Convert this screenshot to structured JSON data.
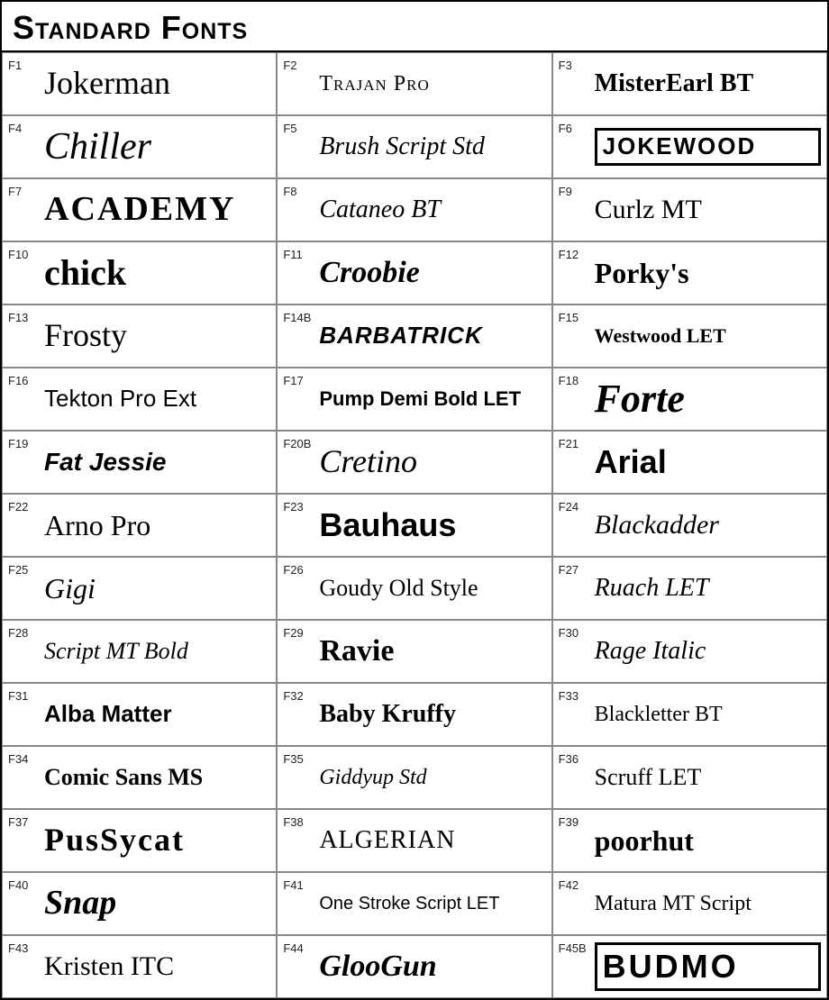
{
  "title": "Standard Fonts",
  "fonts": [
    {
      "code": "F1",
      "name": "Jokerman",
      "style": "f-jokerman"
    },
    {
      "code": "F2",
      "name": "Trajan Pro",
      "style": "f-trajan"
    },
    {
      "code": "F3",
      "name": "MisterEarl BT",
      "style": "f-misterearl"
    },
    {
      "code": "F4",
      "name": "Chiller",
      "style": "f-chiller"
    },
    {
      "code": "F5",
      "name": "Brush Script Std",
      "style": "f-brushscript"
    },
    {
      "code": "F6",
      "name": "JOKEWOOD",
      "style": "jokewood-box"
    },
    {
      "code": "F7",
      "name": "ACADEMY",
      "style": "f-academy"
    },
    {
      "code": "F8",
      "name": "Cataneo BT",
      "style": "f-cataneo"
    },
    {
      "code": "F9",
      "name": "Curlz MT",
      "style": "f-curlzmt"
    },
    {
      "code": "F10",
      "name": "chick",
      "style": "f-chick"
    },
    {
      "code": "F11",
      "name": "Croobie",
      "style": "f-croobie"
    },
    {
      "code": "F12",
      "name": "Porky's",
      "style": "f-porkys"
    },
    {
      "code": "F13",
      "name": "Frosty",
      "style": "f-frosty"
    },
    {
      "code": "F14B",
      "name": "BARBATRICK",
      "style": "f-barbatrick"
    },
    {
      "code": "F15",
      "name": "Westwood LET",
      "style": "f-westwood"
    },
    {
      "code": "F16",
      "name": "Tekton Pro Ext",
      "style": "f-tekton"
    },
    {
      "code": "F17",
      "name": "Pump Demi Bold LET",
      "style": "f-pump"
    },
    {
      "code": "F18",
      "name": "Forte",
      "style": "f-forte"
    },
    {
      "code": "F19",
      "name": "Fat Jessie",
      "style": "f-fatjessie"
    },
    {
      "code": "F20B",
      "name": "Cretino",
      "style": "f-cretino"
    },
    {
      "code": "F21",
      "name": "Arial",
      "style": "f-arial"
    },
    {
      "code": "F22",
      "name": "Arno Pro",
      "style": "f-arnopro"
    },
    {
      "code": "F23",
      "name": "Bauhaus",
      "style": "f-bauhaus"
    },
    {
      "code": "F24",
      "name": "Blackadder",
      "style": "f-blackadder"
    },
    {
      "code": "F25",
      "name": "Gigi",
      "style": "f-gigi"
    },
    {
      "code": "F26",
      "name": "Goudy Old Style",
      "style": "f-goudy"
    },
    {
      "code": "F27",
      "name": "Ruach LET",
      "style": "f-ruach"
    },
    {
      "code": "F28",
      "name": "Script MT Bold",
      "style": "f-scriptmt"
    },
    {
      "code": "F29",
      "name": "Ravie",
      "style": "f-ravie"
    },
    {
      "code": "F30",
      "name": "Rage Italic",
      "style": "f-rage"
    },
    {
      "code": "F31",
      "name": "Alba Matter",
      "style": "f-alba"
    },
    {
      "code": "F32",
      "name": "Baby Kruffy",
      "style": "f-babykruffy"
    },
    {
      "code": "F33",
      "name": "Blackletter BT",
      "style": "f-blackletter"
    },
    {
      "code": "F34",
      "name": "Comic Sans MS",
      "style": "f-comicsans"
    },
    {
      "code": "F35",
      "name": "Giddyup Std",
      "style": "f-giddyup"
    },
    {
      "code": "F36",
      "name": "Scruff LET",
      "style": "f-scruff"
    },
    {
      "code": "F37",
      "name": "PusSycat",
      "style": "f-pussycat"
    },
    {
      "code": "F38",
      "name": "ALGERIAN",
      "style": "f-algerian"
    },
    {
      "code": "F39",
      "name": "poorhut",
      "style": "f-poorhut"
    },
    {
      "code": "F40",
      "name": "Snap",
      "style": "f-snap"
    },
    {
      "code": "F41",
      "name": "One Stroke Script LET",
      "style": "f-onestroke"
    },
    {
      "code": "F42",
      "name": "Matura MT Script",
      "style": "f-matura"
    },
    {
      "code": "F43",
      "name": "Kristen ITC",
      "style": "f-kristen"
    },
    {
      "code": "F44",
      "name": "GlooGun",
      "style": "f-gloogun"
    },
    {
      "code": "F45B",
      "name": "BUDMO",
      "style": "budmo-box"
    }
  ]
}
